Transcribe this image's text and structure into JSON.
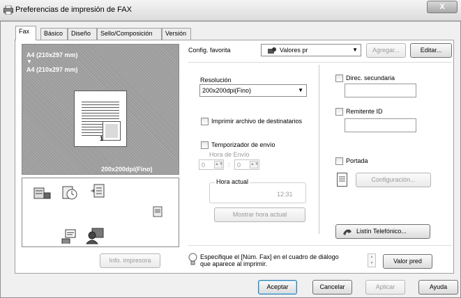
{
  "window": {
    "title": "Preferencias de impresión de FAX",
    "close_label": "X"
  },
  "tabs": [
    {
      "label": "Fax"
    },
    {
      "label": "Básico"
    },
    {
      "label": "Diseño"
    },
    {
      "label": "Sello/Composición"
    },
    {
      "label": "Versión"
    }
  ],
  "preview": {
    "original_size": "A4 (210x297 mm)",
    "arrow": "▼",
    "output_size": "A4 (210x297 mm)",
    "page_number": "1",
    "resolution_text": "200x200dpi(Fino)"
  },
  "left_buttons": {
    "printer_info": "Info. impresora"
  },
  "favorites": {
    "label": "Config. favorita",
    "value": "Valores pr",
    "add": "Agregar...",
    "edit": "Editar..."
  },
  "resolution": {
    "label": "Resolución",
    "value": "200x200dpi(Fino)"
  },
  "print_recipients": {
    "label": "Imprimir archivo de destinatarios"
  },
  "timer": {
    "label": "Temporizador de envío",
    "send_time_label": "Hora de Envío",
    "hour": "0",
    "separator": ":",
    "minute": "0",
    "current_time_label": "Hora actual",
    "current_time": "12:31",
    "show_current_button": "Mostrar hora actual"
  },
  "secondary_address": {
    "label": "Direc. secundaria"
  },
  "sender_id": {
    "label": "Remitente ID"
  },
  "cover": {
    "label": "Portada",
    "config_button": "Configuración..."
  },
  "phonebook": {
    "button": "Listín Telefónico..."
  },
  "hint": {
    "text_line1": "Especifique el [Núm. Fax] en el cuadro de diálogo",
    "text_line2": "que aparece al imprimir.",
    "default_button": "Valor pred"
  },
  "footer": {
    "ok": "Aceptar",
    "cancel": "Cancelar",
    "apply": "Aplicar",
    "help": "Ayuda"
  }
}
